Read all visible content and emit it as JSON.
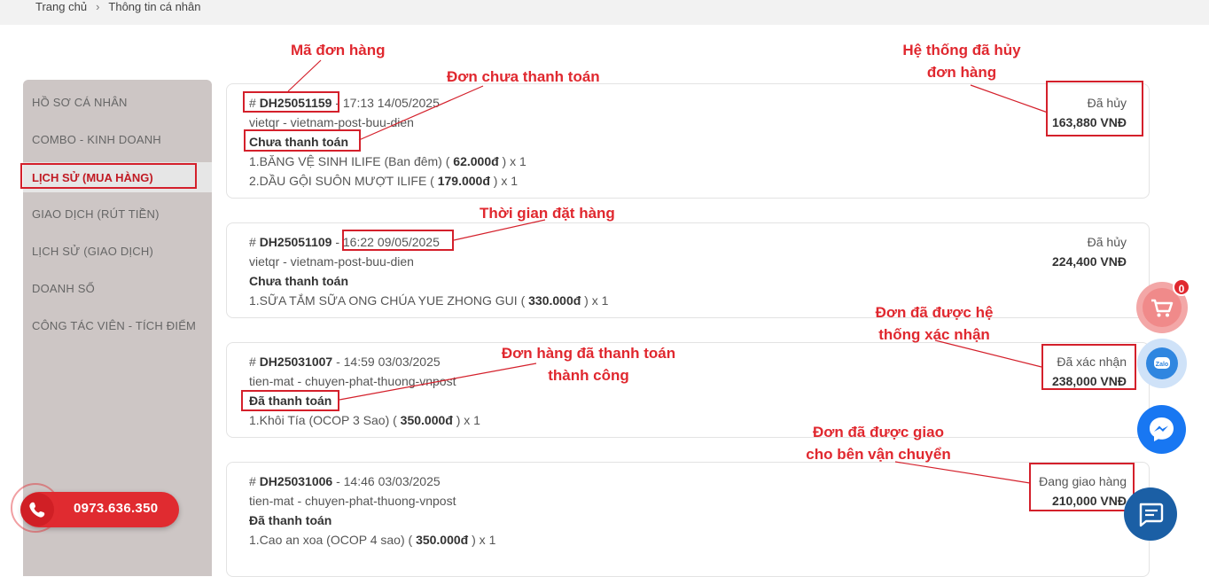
{
  "breadcrumb": {
    "home": "Trang chủ",
    "separator": "›",
    "current": "Thông tin cá nhân"
  },
  "sidebar": {
    "items": [
      {
        "label": "HỒ SƠ CÁ NHÂN"
      },
      {
        "label": "COMBO - KINH DOANH"
      },
      {
        "label": "LỊCH SỬ (MUA HÀNG)",
        "active": true
      },
      {
        "label": "GIAO DỊCH (RÚT TIỀN)"
      },
      {
        "label": "LỊCH SỬ (GIAO DỊCH)"
      },
      {
        "label": "DOANH SỐ"
      },
      {
        "label": "CÔNG TÁC VIÊN - TÍCH ĐIỂM"
      }
    ]
  },
  "orders": [
    {
      "hash": "# ",
      "code": "DH25051159",
      "datetime": " - 17:13 14/05/2025",
      "method": "vietqr - vietnam-post-buu-dien",
      "payment": "Chưa thanh toán",
      "items": [
        {
          "pre": "1.BĂNG VỆ SINH ILIFE (Ban đêm) ( ",
          "price": "62.000đ",
          "post": " ) x 1"
        },
        {
          "pre": "2.DẦU GỘI SUÔN MƯỢT ILIFE ( ",
          "price": "179.000đ",
          "post": " ) x 1"
        }
      ],
      "status": "Đã hủy",
      "amount": "163,880 VNĐ"
    },
    {
      "hash": "# ",
      "code": "DH25051109",
      "sep": " - ",
      "datetime": "16:22 09/05/2025",
      "method": "vietqr - vietnam-post-buu-dien",
      "payment": "Chưa thanh toán",
      "items": [
        {
          "pre": "1.SỮA TẮM SỮA ONG CHÚA YUE ZHONG GUI ( ",
          "price": "330.000đ",
          "post": " ) x 1"
        }
      ],
      "status": "Đã hủy",
      "amount": "224,400 VNĐ"
    },
    {
      "hash": "# ",
      "code": "DH25031007",
      "datetime": " - 14:59 03/03/2025",
      "method": "tien-mat - chuyen-phat-thuong-vnpost",
      "payment": "Đã thanh toán",
      "items": [
        {
          "pre": "1.Khôi Tía (OCOP 3 Sao) ( ",
          "price": "350.000đ",
          "post": " ) x 1"
        }
      ],
      "status": "Đã xác nhận",
      "amount": "238,000 VNĐ"
    },
    {
      "hash": "# ",
      "code": "DH25031006",
      "datetime": " - 14:46 03/03/2025",
      "method": "tien-mat - chuyen-phat-thuong-vnpost",
      "payment": "Đã thanh toán",
      "items": [
        {
          "pre": "1.Cao an xoa (OCOP 4 sao) ( ",
          "price": "350.000đ",
          "post": " ) x 1"
        }
      ],
      "status": "Đang giao hàng",
      "amount": "210,000 VNĐ"
    }
  ],
  "annotations": {
    "order_code": "Mã đơn hàng",
    "unpaid": "Đơn chưa thanh toán",
    "system_cancel_1": "Hệ thống đã hủy",
    "system_cancel_2": "đơn hàng",
    "order_time": "Thời gian đặt hàng",
    "confirmed_1": "Đơn đã được hệ",
    "confirmed_2": "thống xác nhận",
    "paid_1": "Đơn hàng đã thanh toán",
    "paid_2": "thành công",
    "shipping_1": "Đơn đã được giao",
    "shipping_2": "cho bên vận chuyển"
  },
  "contact": {
    "phone": "0973.636.350"
  },
  "floating": {
    "cart_badge": "0",
    "icons": [
      "cart-icon",
      "zalo-icon",
      "messenger-icon",
      "chat-icon"
    ]
  },
  "colors": {
    "accent": "#e0282f",
    "sidebar_bg": "#cdc6c5",
    "zalo": "#2f86e0",
    "messenger": "#1877f2",
    "chat": "#1b5fa5"
  }
}
